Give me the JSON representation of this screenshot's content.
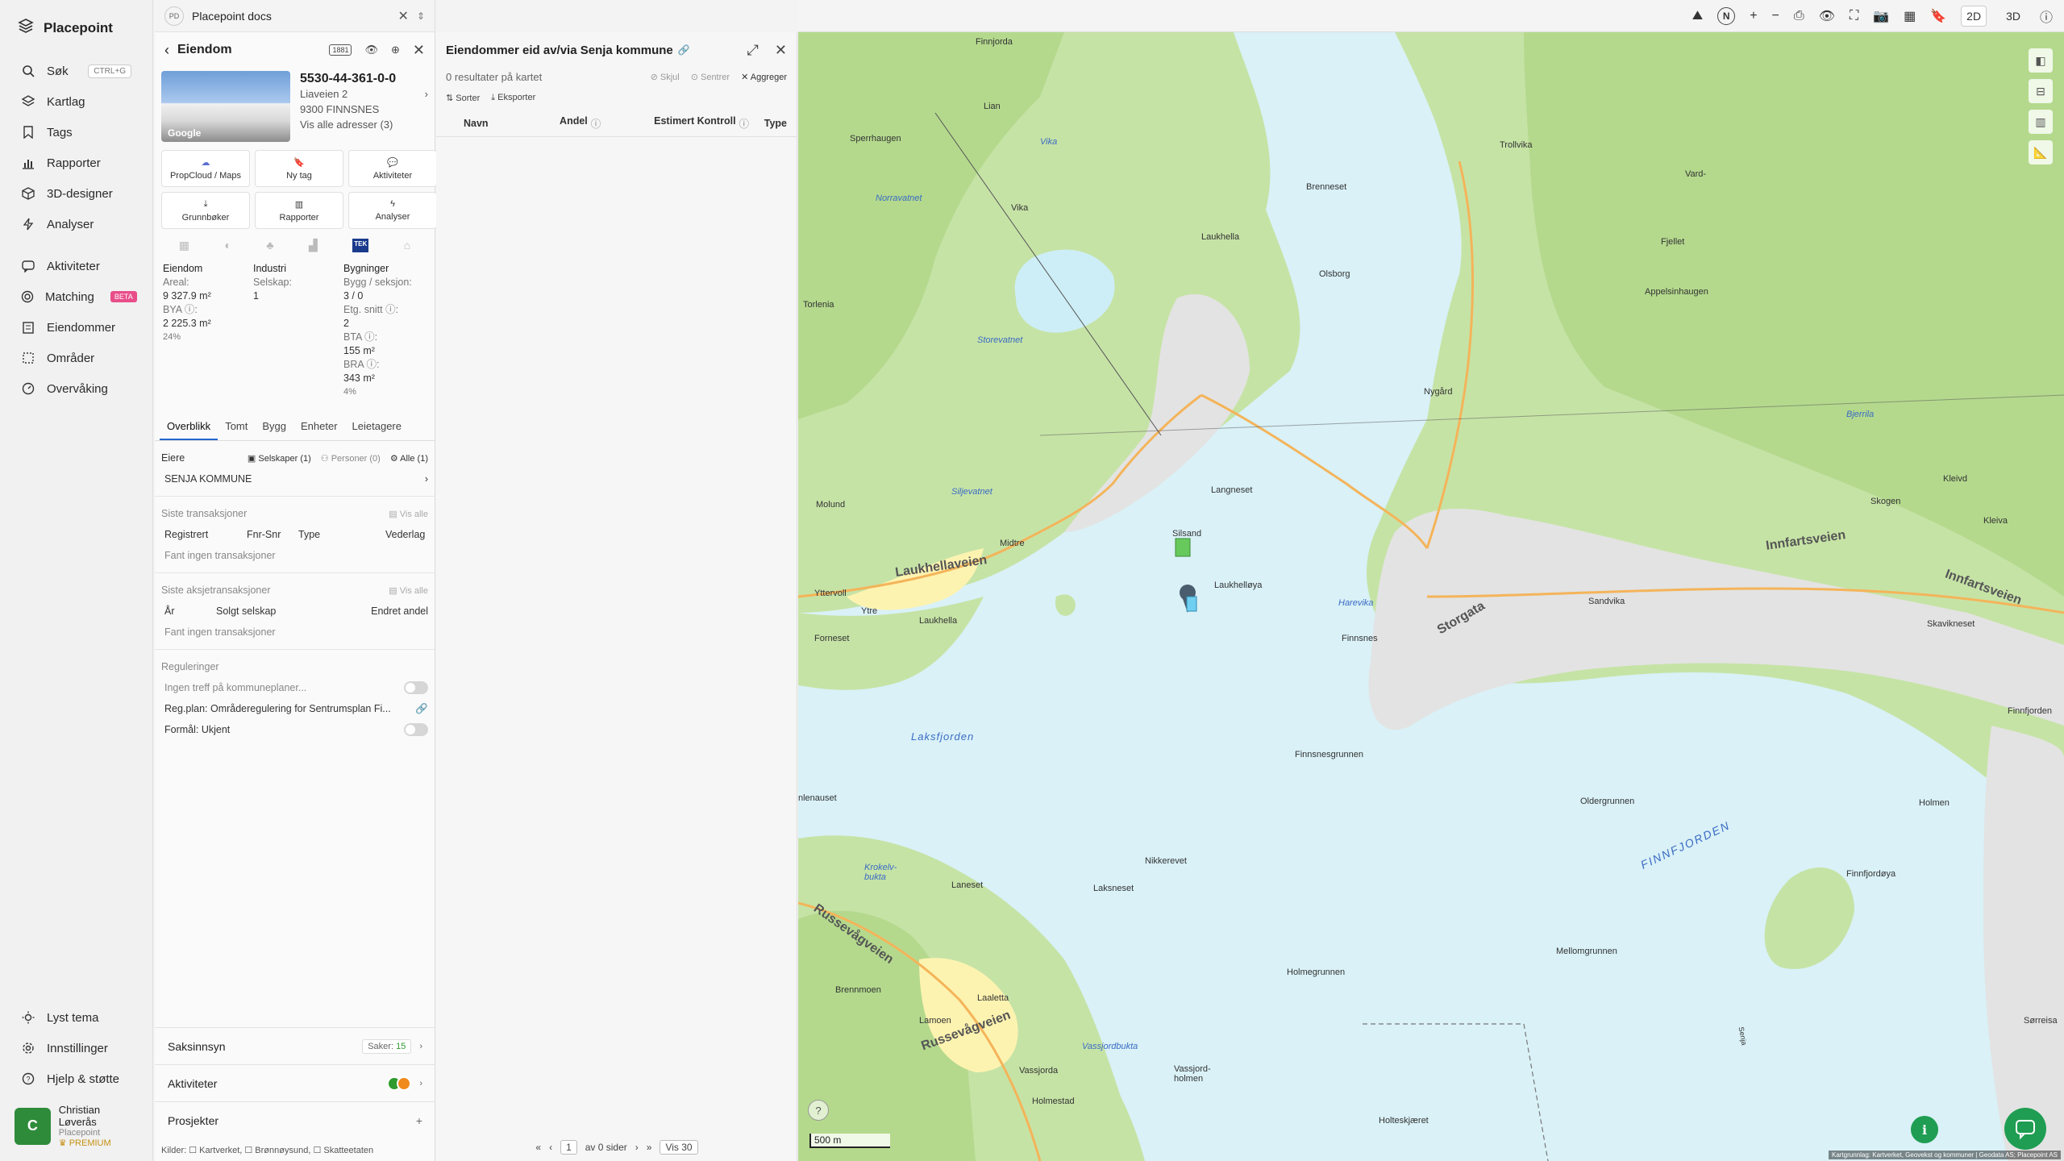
{
  "app": {
    "name": "Placepoint"
  },
  "nav": {
    "items": [
      {
        "label": "Søk",
        "shortcut": "CTRL+G"
      },
      {
        "label": "Kartlag"
      },
      {
        "label": "Tags"
      },
      {
        "label": "Rapporter"
      },
      {
        "label": "3D-designer"
      },
      {
        "label": "Analyser"
      }
    ],
    "items2": [
      {
        "label": "Aktiviteter"
      },
      {
        "label": "Matching",
        "badge": "BETA"
      },
      {
        "label": "Eiendommer"
      },
      {
        "label": "Områder"
      },
      {
        "label": "Overvåking"
      }
    ],
    "bottom": [
      {
        "label": "Lyst tema"
      },
      {
        "label": "Innstillinger"
      },
      {
        "label": "Hjelp & støtte"
      }
    ],
    "user": {
      "initial": "C",
      "name": "Christian Løverås",
      "org": "Placepoint",
      "plan": "PREMIUM"
    }
  },
  "docs": {
    "badge": "PD",
    "title": "Placepoint docs"
  },
  "property": {
    "header": "Eiendom",
    "tag": "1881",
    "thumb_label": "Google",
    "id": "5530-44-361-0-0",
    "street": "Liaveien 2",
    "city": "9300 FINNSNES",
    "all_addresses": "Vis alle adresser (3)",
    "actions": [
      "PropCloud / Maps",
      "Ny tag",
      "Aktiviteter",
      "Grunnbøker",
      "Rapporter",
      "Analyser"
    ],
    "tek": "TEK",
    "facts": {
      "col1_title": "Eiendom",
      "areal_label": "Areal:",
      "areal_value": "9 327.9 m²",
      "bya_label": "BYA ⓘ:",
      "bya_value": "2 225.3 m²",
      "bya_pct": "24%",
      "col2_title": "Industri",
      "selskap_label": "Selskap:",
      "selskap_value": "1",
      "col3_title": "Bygninger",
      "bygg_label": "Bygg / seksjon:",
      "bygg_value": "3 / 0",
      "etg_label": "Etg. snitt ⓘ:",
      "etg_value": "2",
      "bta_label": "BTA ⓘ:",
      "bta_value": "155 m²",
      "bra_label": "BRA ⓘ:",
      "bra_value": "343 m²",
      "bra_pct": "4%"
    },
    "tabs": [
      "Overblikk",
      "Tomt",
      "Bygg",
      "Enheter",
      "Leietagere"
    ],
    "owners": {
      "label": "Eiere",
      "filters": [
        "Selskaper (1)",
        "Personer (0)",
        "Alle (1)"
      ],
      "owner": "SENJA KOMMUNE"
    },
    "transactions": {
      "title": "Siste transaksjoner",
      "show_all": "Vis alle",
      "cols": [
        "Registrert",
        "Fnr-Snr",
        "Type",
        "Vederlag"
      ],
      "empty": "Fant ingen transaksjoner"
    },
    "share_tx": {
      "title": "Siste aksjetransaksjoner",
      "show_all": "Vis alle",
      "cols": [
        "År",
        "Solgt selskap",
        "Endret andel"
      ],
      "empty": "Fant ingen transaksjoner"
    },
    "regulations": {
      "title": "Reguleringer",
      "r1": "Ingen treff på kommuneplaner...",
      "r2": "Reg.plan: Områderegulering for Sentrumsplan Fi...",
      "r3": "Formål: Ukjent"
    },
    "bottom": {
      "saksinnsyn": "Saksinnsyn",
      "saker_label": "Saker:",
      "saker_count": "15",
      "aktiviteter": "Aktiviteter",
      "prosjekter": "Prosjekter"
    },
    "sources": "Kilder: ☐ Kartverket, ☐ Brønnøysund, ☐ Skatteetaten"
  },
  "list": {
    "title": "Eiendommer eid av/via Senja kommune",
    "results": "0 resultater på kartet",
    "hide": "Skjul",
    "center": "Sentrer",
    "aggregate": "Aggreger",
    "sort": "Sorter",
    "export": "Eksporter",
    "cols": [
      "Navn",
      "Andel",
      "Estimert Kontroll",
      "Type"
    ],
    "pager": {
      "page": "1",
      "of": "av 0 sider",
      "per": "Vis 30"
    }
  },
  "topbar": {
    "d2": "2D",
    "d3": "3D",
    "compass": "N"
  },
  "map": {
    "scale": "500 m",
    "credit": "Kartgrunnlag: Kartverket, Geovekst og kommuner | Geodata AS; Placepoint AS",
    "labels": {
      "finnjorda": "Finnjorda",
      "lian": "Lian",
      "vika": "Vika",
      "sperrhaugen": "Sperrhaugen",
      "trollvika": "Trollvika",
      "vard": "Vard-",
      "norravatnet": "Norravatnet",
      "brenneset": "Brenneset",
      "vika2": "Vika",
      "laukhella": "Laukhella",
      "olsborg": "Olsborg",
      "fjellet": "Fjellet",
      "appelsinhaugen": "Appelsinhaugen",
      "torlenia": "Torlenia",
      "storevatnet": "Storevatnet",
      "nygard": "Nygård",
      "siljevatnet": "Siljevatnet",
      "langneset": "Langneset",
      "molund": "Molund",
      "midtre": "Midtre",
      "laukhellaveien": "Laukhellaveien",
      "silsand": "Silsand",
      "laukhellaya": "Laukhelløya",
      "harevika": "Harevika",
      "yttervoll": "Yttervoll",
      "ytre": "Ytre",
      "laukhella2": "Laukhella",
      "forneset": "Forneset",
      "finnsnes": "Finnsnes",
      "storgata": "Storgata",
      "sandvika": "Sandvika",
      "innfartsveien": "Innfartsveien",
      "innfartsveien2": "Innfartsveien",
      "skavikneset": "Skavikneset",
      "kleivd": "Kleivd",
      "skogen": "Skogen",
      "kleiva": "Kleiva",
      "bjerrila": "Bjerrila",
      "laksfjorden": "Laksfjorden",
      "finnsnesgrunnen": "Finnsnesgrunnen",
      "oldergrunnen": "Oldergrunnen",
      "finnfjorden": "FINNFJORDEN",
      "holmen": "Holmen",
      "finnfjordaya": "Finnfjordøya",
      "finnfjorden2": "Finnfjorden",
      "nlenauset": "nlenauset",
      "krokelvbukta": "Krokelv-bukta",
      "laneset": "Laneset",
      "nikkerevet": "Nikkerevet",
      "laksneset": "Laksneset",
      "russevagveien": "Russevågveien",
      "russevagveien2": "Russevågveien",
      "mellomgrunnen": "Mellomgrunnen",
      "brennmoen": "Brennmoen",
      "laaletta": "Laaletta",
      "holmegrunnen": "Holmegrunnen",
      "lamoen": "Lamoen",
      "vassjordbukta": "Vassjordbukta",
      "vassjorda": "Vassjorda",
      "vassjordholmen": "Vassjord-holmen",
      "holmesta": "Holmestad",
      "holteskjaeret": "Holteskjæret",
      "senja": "Senja",
      "sorreisa": "Sørreisa"
    }
  }
}
